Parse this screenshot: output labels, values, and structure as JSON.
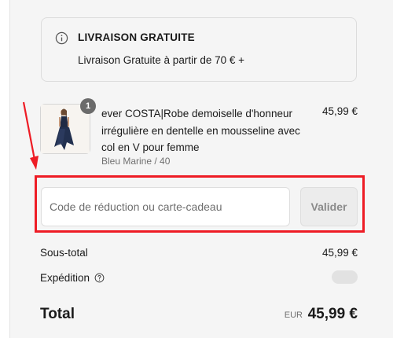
{
  "shipping_banner": {
    "icon": "info-icon",
    "title": "LIVRAISON GRATUITE",
    "text": "Livraison Gratuite à partir de 70 € +"
  },
  "cart_item": {
    "quantity": "1",
    "name": "ever COSTA|Robe demoiselle d'honneur irrégulière en dentelle en mousseline avec col en V pour femme",
    "variant": "Bleu Marine / 40",
    "price": "45,99 €"
  },
  "discount": {
    "placeholder": "Code de réduction ou carte-cadeau",
    "value": "",
    "button_label": "Valider"
  },
  "summary": {
    "subtotal_label": "Sous-total",
    "subtotal_value": "45,99 €",
    "shipping_label": "Expédition",
    "shipping_help_icon": "question-circle-icon",
    "total_label": "Total",
    "total_currency": "EUR",
    "total_value": "45,99 €"
  },
  "annotation_colors": {
    "highlight": "#ee1c25"
  }
}
